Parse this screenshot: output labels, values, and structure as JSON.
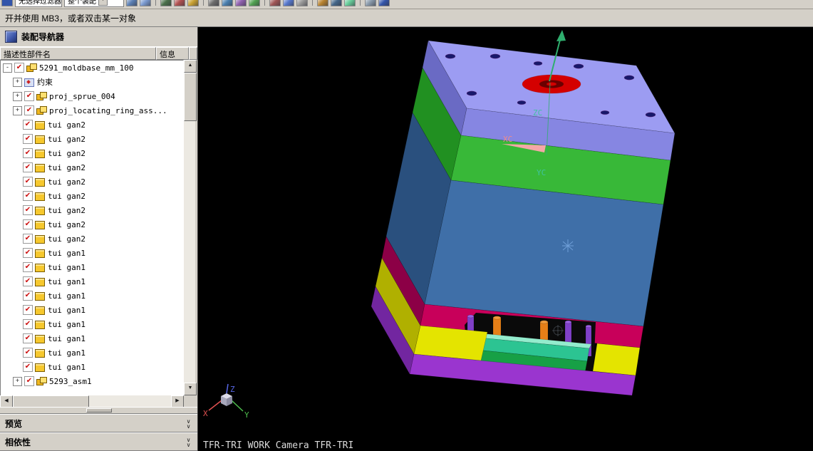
{
  "toolbar": {
    "filter_combo": "无选择过滤器",
    "scope_combo": "整个装配",
    "icons": [
      {
        "name": "tb-icon-1",
        "color": "#5b7fb4"
      },
      {
        "name": "tb-icon-2",
        "color": "#7a9ad0"
      },
      {
        "sep": true
      },
      {
        "name": "tb-icon-3",
        "color": "#4a6f4a"
      },
      {
        "name": "tb-icon-4",
        "color": "#b05050"
      },
      {
        "name": "tb-icon-5",
        "color": "#c8a030"
      },
      {
        "sep": true
      },
      {
        "name": "tb-icon-6",
        "color": "#6d6d6d"
      },
      {
        "name": "tb-icon-7",
        "color": "#4a7fae"
      },
      {
        "name": "tb-icon-8",
        "color": "#8f5fae"
      },
      {
        "name": "tb-icon-9",
        "color": "#50a050"
      },
      {
        "sep": true
      },
      {
        "name": "tb-icon-10",
        "color": "#a05555"
      },
      {
        "name": "tb-icon-11",
        "color": "#5577cc"
      },
      {
        "name": "tb-icon-12",
        "color": "#999999"
      },
      {
        "sep": true
      },
      {
        "name": "tb-icon-13",
        "color": "#b88330"
      },
      {
        "name": "tb-icon-14",
        "color": "#446688"
      },
      {
        "name": "tb-icon-15",
        "color": "#66cc99"
      },
      {
        "sep": true
      },
      {
        "name": "tb-icon-16",
        "color": "#8899aa"
      },
      {
        "name": "tb-icon-17",
        "color": "#3355aa"
      }
    ]
  },
  "prompt": "开并使用 MB3，或者双击某一对象",
  "navigator": {
    "title": "装配导航器",
    "col_name": "描述性部件名",
    "col_info": "信息",
    "rows": [
      {
        "label": "5291_moldbase_mm_100",
        "level": 0,
        "expander": "minus",
        "checked": true,
        "icon": "assembly"
      },
      {
        "label": "约束",
        "level": 1,
        "expander": "plus",
        "checked": null,
        "icon": "constraints"
      },
      {
        "label": "proj_sprue_004",
        "level": 1,
        "expander": "plus",
        "checked": true,
        "icon": "assembly"
      },
      {
        "label": "proj_locating_ring_ass...",
        "level": 1,
        "expander": "plus",
        "checked": true,
        "icon": "assembly"
      },
      {
        "label": "tui gan2",
        "level": 1,
        "expander": null,
        "checked": true,
        "icon": "part"
      },
      {
        "label": "tui gan2",
        "level": 1,
        "expander": null,
        "checked": true,
        "icon": "part"
      },
      {
        "label": "tui gan2",
        "level": 1,
        "expander": null,
        "checked": true,
        "icon": "part"
      },
      {
        "label": "tui gan2",
        "level": 1,
        "expander": null,
        "checked": true,
        "icon": "part"
      },
      {
        "label": "tui gan2",
        "level": 1,
        "expander": null,
        "checked": true,
        "icon": "part"
      },
      {
        "label": "tui gan2",
        "level": 1,
        "expander": null,
        "checked": true,
        "icon": "part"
      },
      {
        "label": "tui gan2",
        "level": 1,
        "expander": null,
        "checked": true,
        "icon": "part"
      },
      {
        "label": "tui gan2",
        "level": 1,
        "expander": null,
        "checked": true,
        "icon": "part"
      },
      {
        "label": "tui gan2",
        "level": 1,
        "expander": null,
        "checked": true,
        "icon": "part"
      },
      {
        "label": "tui gan1",
        "level": 1,
        "expander": null,
        "checked": true,
        "icon": "part"
      },
      {
        "label": "tui gan1",
        "level": 1,
        "expander": null,
        "checked": true,
        "icon": "part"
      },
      {
        "label": "tui gan1",
        "level": 1,
        "expander": null,
        "checked": true,
        "icon": "part"
      },
      {
        "label": "tui gan1",
        "level": 1,
        "expander": null,
        "checked": true,
        "icon": "part"
      },
      {
        "label": "tui gan1",
        "level": 1,
        "expander": null,
        "checked": true,
        "icon": "part"
      },
      {
        "label": "tui gan1",
        "level": 1,
        "expander": null,
        "checked": true,
        "icon": "part"
      },
      {
        "label": "tui gan1",
        "level": 1,
        "expander": null,
        "checked": true,
        "icon": "part"
      },
      {
        "label": "tui gan1",
        "level": 1,
        "expander": null,
        "checked": true,
        "icon": "part"
      },
      {
        "label": "tui gan1",
        "level": 1,
        "expander": null,
        "checked": true,
        "icon": "part"
      },
      {
        "label": "5293_asm1",
        "level": 1,
        "expander": "plus",
        "checked": true,
        "icon": "assembly"
      }
    ],
    "sections": {
      "preview": "预览",
      "dependencies": "相依性"
    }
  },
  "viewport": {
    "status": "TFR-TRI WORK Camera TFR-TRI",
    "labels": {
      "zc": "ZC",
      "xc": "XC",
      "yc": "YC",
      "x": "X",
      "y": "Y",
      "z": "Z"
    }
  },
  "colors": {
    "top_top": "#9c9cf2",
    "top_front": "#8686e2",
    "top_left": "#6a6ac4",
    "green_front": "#38b838",
    "green_left": "#219021",
    "blue_front": "#3f6fa8",
    "blue_left": "#2a507e",
    "magenta_front": "#c8005a",
    "magenta_left": "#8c0046",
    "yellow_front": "#e4e400",
    "yellow_left": "#b0b000",
    "bottom_front": "#9a35cf",
    "bottom_left": "#7226a0",
    "ring": "#d40000",
    "ring_hole": "#6a0000",
    "ejector_teal": "#2cc492",
    "ejector_teal_top": "#93eccd",
    "ejector_green": "#17a046",
    "pin_orange": "#e67f17",
    "pin_purple": "#8040c8",
    "opening": "#0a0a0a",
    "axis_green": "#2fae6e",
    "axis_pink": "#f4a7a7",
    "label_teal": "#3fc39f",
    "label_pink": "#f08a8a",
    "triad_x": "#e05050",
    "triad_y": "#4fc04f",
    "triad_z": "#5868e8",
    "status_text": "#dcdcdc"
  }
}
